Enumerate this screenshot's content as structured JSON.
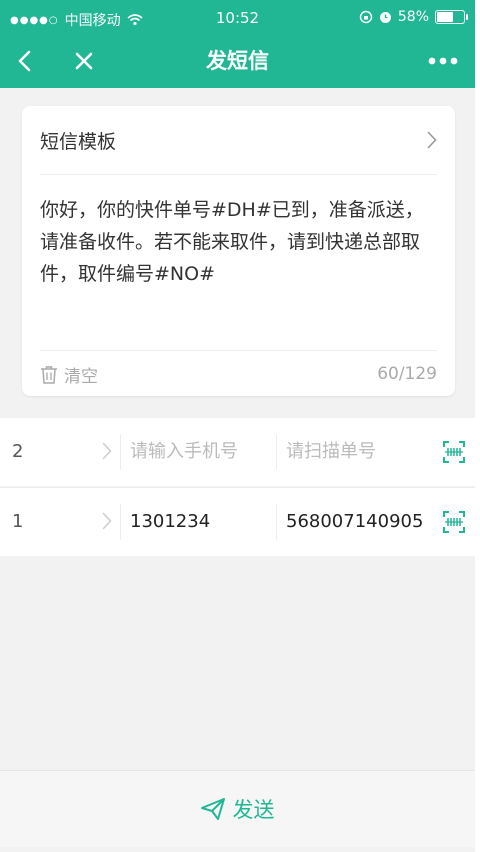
{
  "colors": {
    "accent": "#21b795",
    "background": "#f2f2f2"
  },
  "status_bar": {
    "carrier": "中国移动",
    "time": "10:52",
    "battery": "58%",
    "icons": [
      "signal-dots-icon",
      "wifi-icon",
      "lock-rotation-icon",
      "alarm-icon",
      "battery-icon"
    ]
  },
  "nav": {
    "title": "发短信",
    "back_icon": "chevron-left-icon",
    "close_icon": "close-icon",
    "more_icon": "more-dots-icon"
  },
  "template_card": {
    "label": "短信模板",
    "message": "你好，你的快件单号#DH#已到，准备派送，请准备收件。若不能来取件，请到快递总部取件，取件编号#NO#",
    "clear_label": "清空",
    "count": "60/129"
  },
  "rows": [
    {
      "index": "2",
      "phone_placeholder": "请输入手机号",
      "phone_value": "",
      "order_placeholder": "请扫描单号",
      "order_value": ""
    },
    {
      "index": "1",
      "phone_placeholder": "",
      "phone_value": "1301234",
      "order_placeholder": "",
      "order_value": "568007140905"
    }
  ],
  "bottom": {
    "send_label": "发送"
  }
}
